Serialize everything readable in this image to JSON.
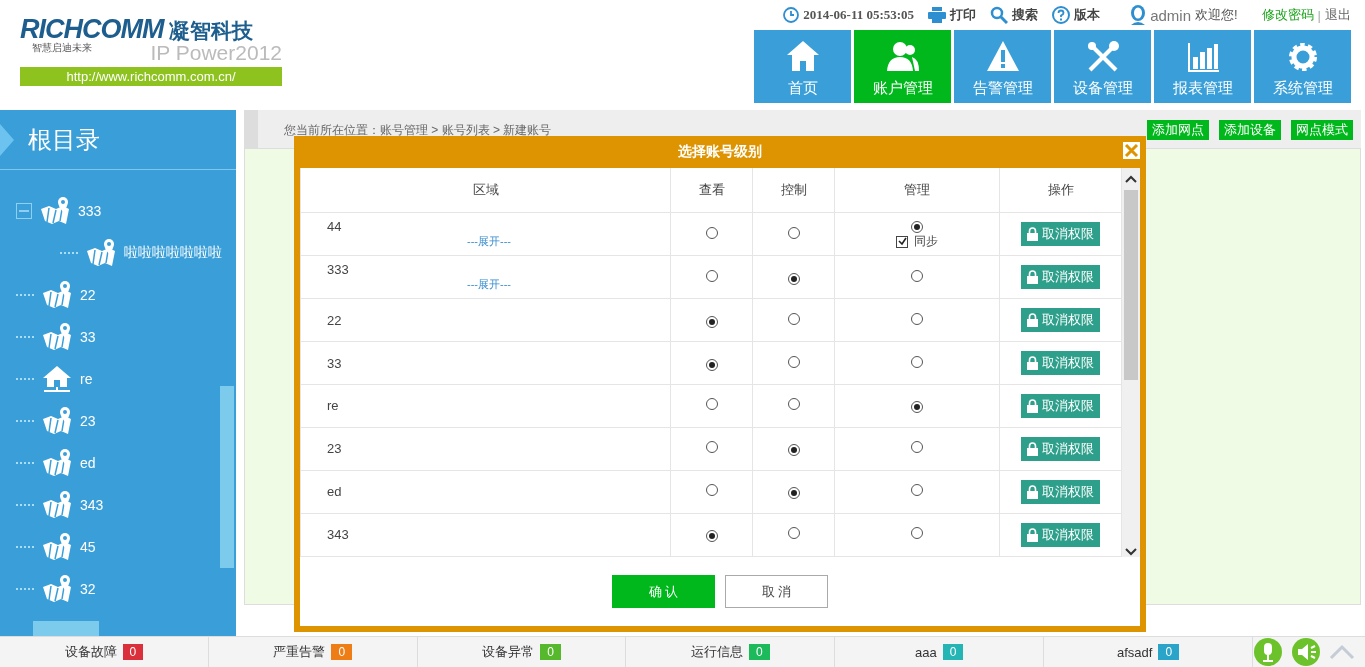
{
  "header": {
    "logo": {
      "brand": "RICHCOMM",
      "cn_name": "凝智科技",
      "slogan": "智慧启迪未来",
      "product": "IP Power2012",
      "url": "http://www.richcomm.com.cn/"
    },
    "datetime": "2014-06-11 05:53:05",
    "tools": [
      {
        "label": "打印",
        "kind": "printer"
      },
      {
        "label": "搜索",
        "kind": "search"
      },
      {
        "label": "版本",
        "kind": "help"
      }
    ],
    "user": {
      "name": "admin",
      "greeting": "欢迎您!"
    },
    "links": [
      {
        "label": "修改密码",
        "kind": "accent"
      },
      {
        "label": "|",
        "kind": "separator"
      },
      {
        "label": "退出",
        "kind": "plain"
      }
    ],
    "nav": [
      {
        "label": "首页",
        "kind": "home",
        "selected": false
      },
      {
        "label": "账户管理",
        "kind": "users",
        "selected": true
      },
      {
        "label": "告警管理",
        "kind": "warning",
        "selected": false
      },
      {
        "label": "设备管理",
        "kind": "tools",
        "selected": false
      },
      {
        "label": "报表管理",
        "kind": "chart",
        "selected": false
      },
      {
        "label": "系统管理",
        "kind": "gear",
        "selected": false
      }
    ]
  },
  "sidebar": {
    "title": "根目录",
    "tree": [
      {
        "label": "333",
        "kind": "map",
        "expanded": true,
        "children": [
          {
            "label": "啦啦啦啦啦啦啦",
            "kind": "map"
          }
        ]
      },
      {
        "label": "22",
        "kind": "map"
      },
      {
        "label": "33",
        "kind": "map"
      },
      {
        "label": "re",
        "kind": "home"
      },
      {
        "label": "23",
        "kind": "map"
      },
      {
        "label": "ed",
        "kind": "map"
      },
      {
        "label": "343",
        "kind": "map"
      },
      {
        "label": "45",
        "kind": "map"
      },
      {
        "label": "32",
        "kind": "map"
      }
    ]
  },
  "breadcrumb": "您当前所在位置：账号管理 > 账号列表 > 新建账号",
  "page_actions": [
    "添加网点",
    "添加设备",
    "网点模式"
  ],
  "dialog": {
    "title": "选择账号级别",
    "columns": [
      "区域",
      "查看",
      "控制",
      "管理",
      "操作"
    ],
    "rows": [
      {
        "area": "44",
        "expand": "---展开---",
        "levels": [
          {
            "selected": false
          },
          {
            "selected": false
          },
          {
            "selected": true
          }
        ],
        "sync": {
          "label": "同步",
          "checked": true
        },
        "action": "取消权限"
      },
      {
        "area": "333",
        "expand": "---展开---",
        "levels": [
          {
            "selected": false
          },
          {
            "selected": true
          },
          {
            "selected": false
          }
        ],
        "action": "取消权限"
      },
      {
        "area": "22",
        "levels": [
          {
            "selected": true
          },
          {
            "selected": false
          },
          {
            "selected": false
          }
        ],
        "action": "取消权限"
      },
      {
        "area": "33",
        "levels": [
          {
            "selected": true
          },
          {
            "selected": false
          },
          {
            "selected": false
          }
        ],
        "action": "取消权限"
      },
      {
        "area": "re",
        "levels": [
          {
            "selected": false
          },
          {
            "selected": false
          },
          {
            "selected": true
          }
        ],
        "action": "取消权限"
      },
      {
        "area": "23",
        "levels": [
          {
            "selected": false
          },
          {
            "selected": true
          },
          {
            "selected": false
          }
        ],
        "action": "取消权限"
      },
      {
        "area": "ed",
        "levels": [
          {
            "selected": false
          },
          {
            "selected": true
          },
          {
            "selected": false
          }
        ],
        "action": "取消权限"
      },
      {
        "area": "343",
        "levels": [
          {
            "selected": true
          },
          {
            "selected": false
          },
          {
            "selected": false
          }
        ],
        "action": "取消权限"
      }
    ],
    "buttons": [
      {
        "label": "确 认",
        "kind": "primary"
      },
      {
        "label": "取 消",
        "kind": "secondary"
      }
    ]
  },
  "status_bar": {
    "items": [
      {
        "label": "设备故障",
        "count": "0",
        "color": "#d9303b"
      },
      {
        "label": "严重告警",
        "count": "0",
        "color": "#ee7d16"
      },
      {
        "label": "设备异常",
        "count": "0",
        "color": "#56b82c"
      },
      {
        "label": "运行信息",
        "count": "0",
        "color": "#1dba5c"
      },
      {
        "label": "aaa",
        "count": "0",
        "color": "#26b5b5"
      },
      {
        "label": "afsadf",
        "count": "0",
        "color": "#2aa4c8"
      }
    ]
  }
}
